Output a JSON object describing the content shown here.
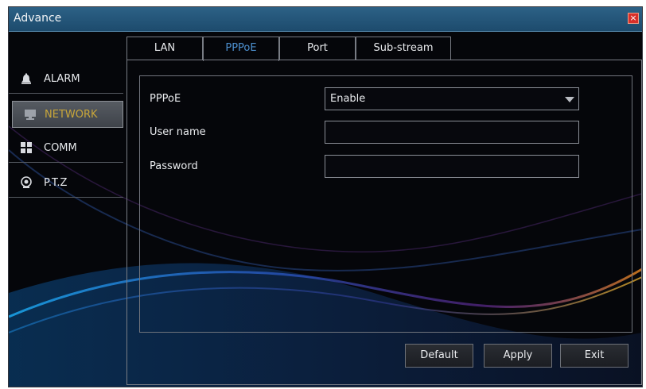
{
  "window": {
    "title": "Advance",
    "close_glyph": "×",
    "colors": {
      "titlebar": "#2c6186",
      "close": "#d8302a",
      "accent_tab": "#4d90d0",
      "active_menu_text": "#c8a63a"
    }
  },
  "sidebar": {
    "items": [
      {
        "label": "ALARM",
        "icon": "bell-icon"
      },
      {
        "label": "NETWORK",
        "icon": "network-icon",
        "active": true
      },
      {
        "label": "COMM",
        "icon": "grid-icon"
      },
      {
        "label": "P.T.Z",
        "icon": "camera-icon"
      }
    ]
  },
  "tabs": [
    {
      "label": "LAN"
    },
    {
      "label": "PPPoE",
      "active": true
    },
    {
      "label": "Port"
    },
    {
      "label": "Sub-stream"
    }
  ],
  "form": {
    "pppoe_label": "PPPoE",
    "pppoe_value": "Enable",
    "username_label": "User name",
    "username_value": "",
    "password_label": "Password",
    "password_value": ""
  },
  "buttons": {
    "default": "Default",
    "apply": "Apply",
    "exit": "Exit"
  }
}
